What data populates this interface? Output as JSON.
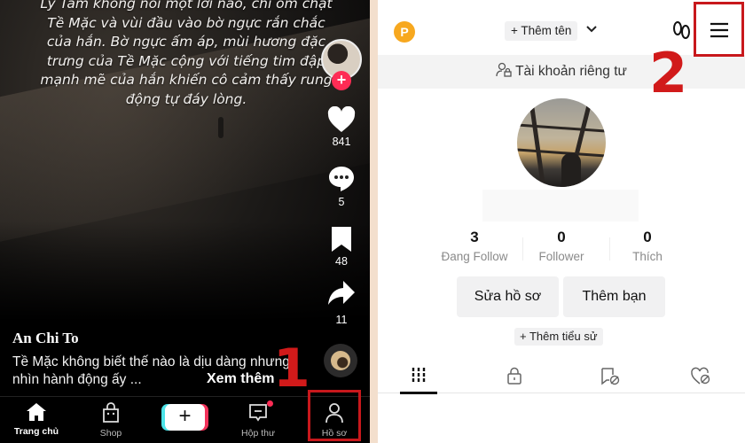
{
  "left_screen": {
    "video_caption": "Ly Tâm không nói một lời nào, chỉ ôm chặt Tề Mặc và vùi đầu vào bờ ngực rắn chắc của hắn. Bờ ngực ấm áp, mùi hương đặc trưng của Tề Mặc cộng với tiếng tim đập mạnh mẽ của hắn khiến cô cảm thấy rung động tự đáy lòng.",
    "action_rail": {
      "likes": "841",
      "comments": "5",
      "bookmarks": "48",
      "shares": "11",
      "follow_glyph": "+"
    },
    "author": "An Chi To",
    "description": "Tề Mặc không biết thế nào là dịu dàng nhưng nhìn hành động ấy ...",
    "see_more": "Xem thêm",
    "tabbar": [
      {
        "label": "Trang chủ",
        "icon": "home-icon",
        "active": true
      },
      {
        "label": "Shop",
        "icon": "shop-bag-icon",
        "active": false
      },
      {
        "label": "",
        "icon": "create-plus-icon",
        "active": false,
        "glyph": "+"
      },
      {
        "label": "Hộp thư",
        "icon": "inbox-icon",
        "active": false,
        "badge": true
      },
      {
        "label": "Hồ sơ",
        "icon": "profile-icon",
        "active": false
      }
    ],
    "step_marker": "1"
  },
  "right_screen": {
    "coin_glyph": "P",
    "add_name": "+ Thêm tên",
    "private_account": "Tài khoản riêng tư",
    "stats": [
      {
        "value": "3",
        "label": "Đang Follow"
      },
      {
        "value": "0",
        "label": "Follower"
      },
      {
        "value": "0",
        "label": "Thích"
      }
    ],
    "buttons": {
      "edit_profile": "Sửa hồ sơ",
      "add_friends": "Thêm bạn"
    },
    "add_bio": "+ Thêm tiểu sử",
    "content_tabs": [
      {
        "icon": "videos-grid-icon",
        "active": true
      },
      {
        "icon": "private-lock-icon",
        "active": false
      },
      {
        "icon": "reposts-hidden-icon",
        "active": false
      },
      {
        "icon": "liked-hidden-icon",
        "active": false
      }
    ],
    "step_marker": "2"
  },
  "colors": {
    "accent_red": "#fe2c55",
    "annotation_red": "#c8181c",
    "coin_orange": "#f7a81f"
  }
}
